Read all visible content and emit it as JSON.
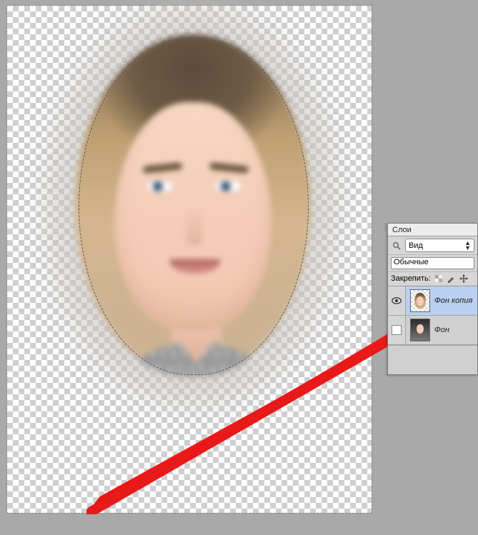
{
  "panel": {
    "title": "Слои",
    "filter_kind": "Вид",
    "blend_mode": "Обычные",
    "lock_label": "Закрепить:",
    "layers": [
      {
        "name": "Фон копия",
        "visible": true,
        "selected": true,
        "transparent_bg": true
      },
      {
        "name": "Фон",
        "visible": false,
        "selected": false,
        "transparent_bg": false
      }
    ]
  }
}
